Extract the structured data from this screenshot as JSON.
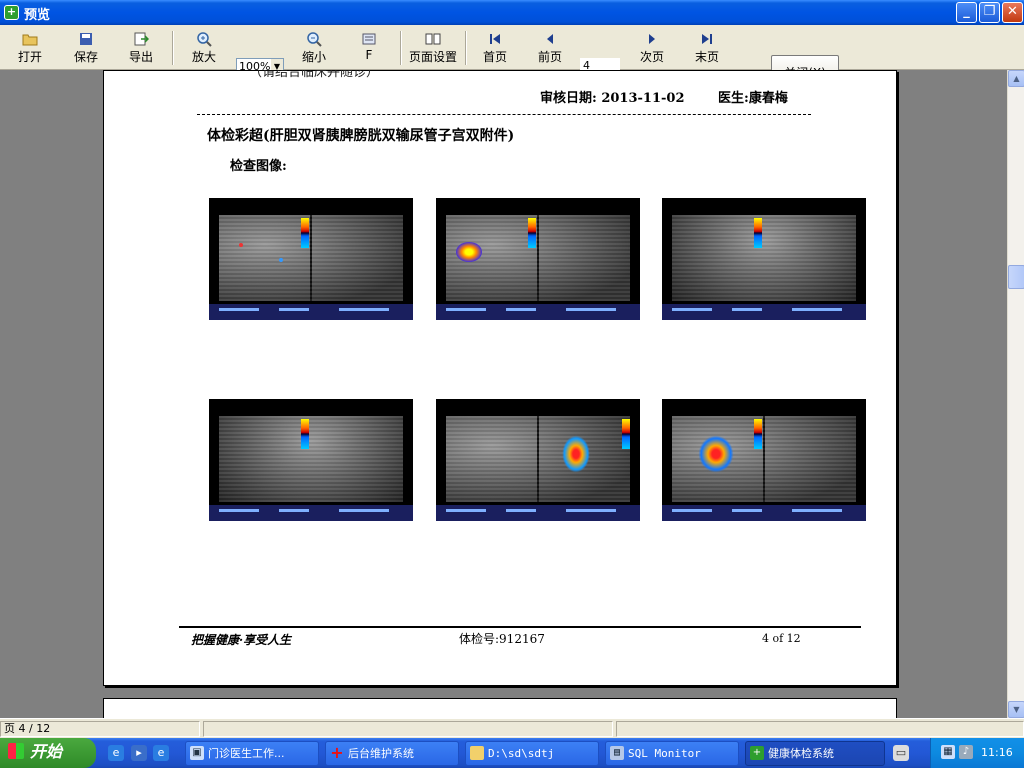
{
  "window": {
    "title": "预览",
    "app_icon": "health-plus-icon"
  },
  "toolbar": {
    "open": "打开",
    "save": "保存",
    "export": "导出",
    "zoom_in": "放大",
    "zoom_value": "100%",
    "zoom_out": "缩小",
    "fit": "F",
    "page_setup": "页面设置",
    "first": "首页",
    "prev": "前页",
    "page_input": "4",
    "next": "次页",
    "last": "末页",
    "close": "关闭(X)"
  },
  "report": {
    "cut_text": "（请结合临床并随诊）",
    "review_label": "审核日期:",
    "review_date": "2013-11-02",
    "doctor_label": "医生:",
    "doctor_name": "康春梅",
    "section_title": "体检彩超(肝胆双肾胰脾膀胱双输尿管子宫双附件)",
    "images_label": "检查图像:",
    "images": [
      {
        "name": "ultrasound-image-1"
      },
      {
        "name": "ultrasound-image-2"
      },
      {
        "name": "ultrasound-image-3"
      },
      {
        "name": "ultrasound-image-4"
      },
      {
        "name": "ultrasound-image-5"
      },
      {
        "name": "ultrasound-image-6"
      }
    ],
    "footer": {
      "slogan": "把握健康·享受人生",
      "exam_label": "体检号:",
      "exam_no": "912167",
      "page_of": "4 of 12"
    }
  },
  "status": {
    "page": "页 4 / 12"
  },
  "taskbar": {
    "start": "开始",
    "tasks": [
      {
        "label": "门诊医生工作...",
        "icon": "window-icon"
      },
      {
        "label": "后台维护系统",
        "icon": "red-cross-icon"
      },
      {
        "label": "D:\\sd\\sdtj",
        "icon": "folder-icon"
      },
      {
        "label": "SQL Monitor",
        "icon": "monitor-icon"
      },
      {
        "label": "健康体检系统",
        "icon": "health-plus-icon"
      }
    ],
    "clock": "11:16"
  }
}
